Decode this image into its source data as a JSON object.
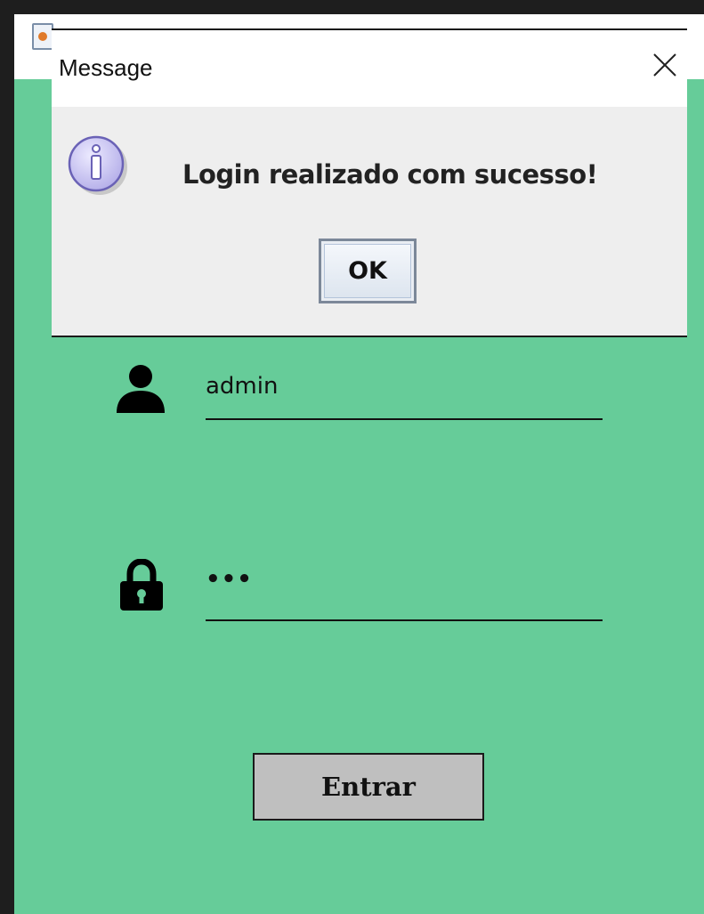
{
  "login": {
    "username_value": "admin",
    "password_value": "•••",
    "submit_label": "Entrar"
  },
  "dialog": {
    "title": "Message",
    "message": "Login realizado com sucesso!",
    "ok_label": "OK"
  },
  "colors": {
    "background": "#66cc99",
    "dialog_bg": "#eeeeee",
    "button_bg": "#bfbfbf"
  },
  "icons": {
    "username": "user-icon",
    "password": "lock-icon",
    "dialog": "info-icon",
    "close": "close-icon"
  }
}
